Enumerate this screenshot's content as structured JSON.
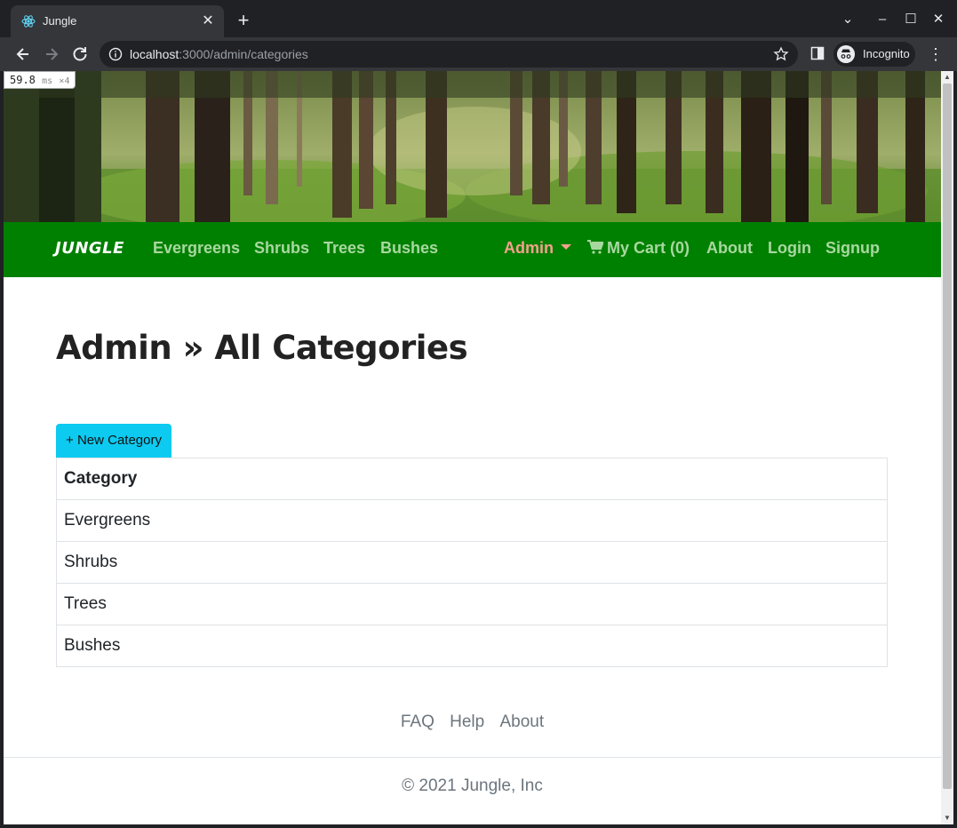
{
  "browser": {
    "tab_title": "Jungle",
    "url_host": "localhost",
    "url_path": ":3000/admin/categories",
    "incognito_label": "Incognito"
  },
  "perf_badge": {
    "value": "59.8",
    "unit": "ms",
    "multiplier": "×4"
  },
  "navbar": {
    "brand": "JUNGLE",
    "links": [
      "Evergreens",
      "Shrubs",
      "Trees",
      "Bushes"
    ],
    "admin": "Admin",
    "cart": "My Cart (0)",
    "about": "About",
    "login": "Login",
    "signup": "Signup",
    "bg_color": "#008000"
  },
  "page": {
    "title": "Admin » All Categories",
    "new_button": "+ New Category",
    "table_header": "Category",
    "rows": [
      "Evergreens",
      "Shrubs",
      "Trees",
      "Bushes"
    ]
  },
  "footer": {
    "links": [
      "FAQ",
      "Help",
      "About"
    ],
    "copyright": "© 2021 Jungle, Inc"
  },
  "icons": {
    "favicon": "react-icon",
    "cart": "shopping-cart-icon",
    "info": "info-icon",
    "star": "bookmark-star-icon"
  }
}
